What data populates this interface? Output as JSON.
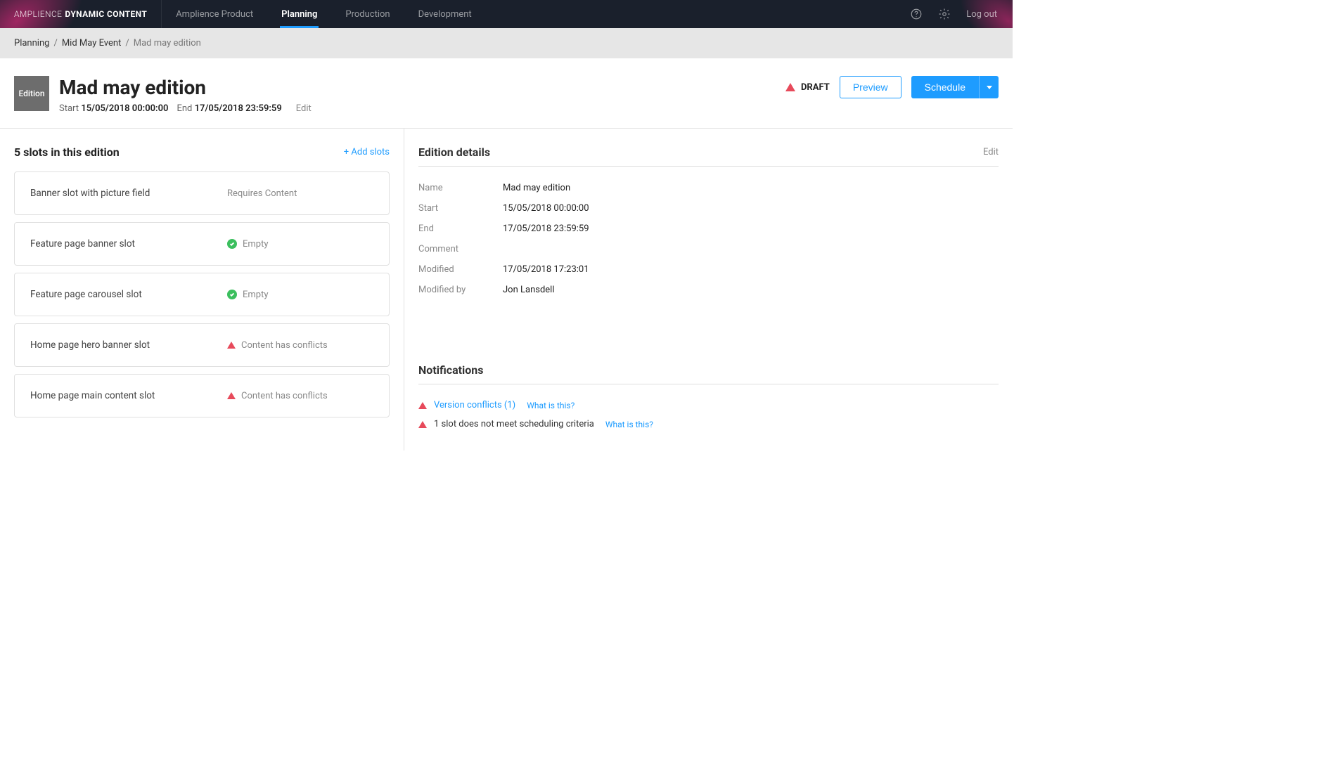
{
  "brand": {
    "light": "AMPLIENCE",
    "bold": "DYNAMIC CONTENT"
  },
  "topnav": {
    "product_label": "Amplience Product",
    "items": [
      {
        "label": "Planning",
        "active": true
      },
      {
        "label": "Production",
        "active": false
      },
      {
        "label": "Development",
        "active": false
      }
    ],
    "logout": "Log out"
  },
  "breadcrumb": {
    "items": [
      {
        "label": "Planning",
        "link": true
      },
      {
        "label": "Mid May Event",
        "link": true
      },
      {
        "label": "Mad may edition",
        "link": false
      }
    ]
  },
  "header": {
    "badge": "Edition",
    "title": "Mad may edition",
    "start_label": "Start",
    "start_value": "15/05/2018 00:00:00",
    "end_label": "End",
    "end_value": "17/05/2018 23:59:59",
    "edit": "Edit",
    "status": "DRAFT",
    "preview_btn": "Preview",
    "schedule_btn": "Schedule"
  },
  "slots": {
    "heading": "5 slots in this edition",
    "add": "+ Add slots",
    "items": [
      {
        "name": "Banner slot with picture field",
        "status": "Requires Content",
        "icon": "none"
      },
      {
        "name": "Feature page banner slot",
        "status": "Empty",
        "icon": "check"
      },
      {
        "name": "Feature page carousel slot",
        "status": "Empty",
        "icon": "check"
      },
      {
        "name": "Home page hero banner slot",
        "status": "Content has conflicts",
        "icon": "warn"
      },
      {
        "name": "Home page main content slot",
        "status": "Content has conflicts",
        "icon": "warn"
      }
    ]
  },
  "details": {
    "heading": "Edition details",
    "edit": "Edit",
    "rows": [
      {
        "label": "Name",
        "value": "Mad may edition"
      },
      {
        "label": "Start",
        "value": "15/05/2018 00:00:00"
      },
      {
        "label": "End",
        "value": "17/05/2018 23:59:59"
      },
      {
        "label": "Comment",
        "value": ""
      },
      {
        "label": "Modified",
        "value": "17/05/2018 17:23:01"
      },
      {
        "label": "Modified by",
        "value": "Jon Lansdell"
      }
    ]
  },
  "notifications": {
    "heading": "Notifications",
    "items": [
      {
        "text": "Version conflicts (1)",
        "style": "link",
        "what": "What is this?"
      },
      {
        "text": "1 slot does not meet scheduling criteria",
        "style": "plain",
        "what": "What is this?"
      }
    ]
  }
}
